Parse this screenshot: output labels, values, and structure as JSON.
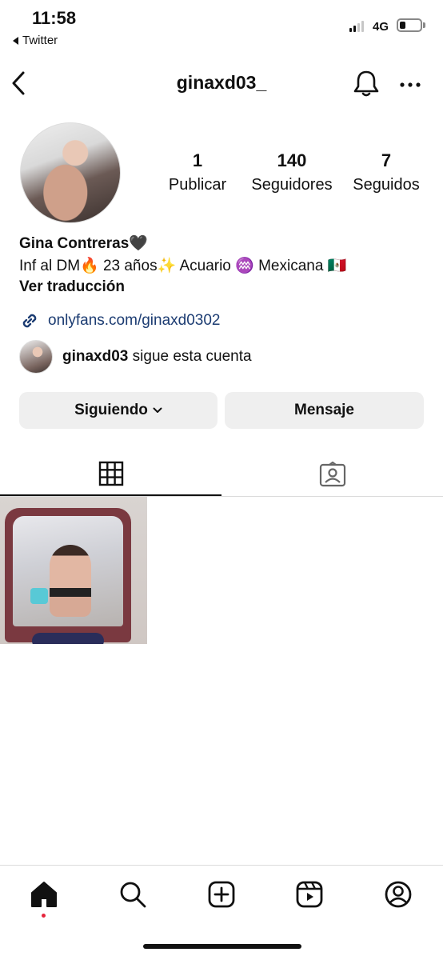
{
  "status_bar": {
    "time": "11:58",
    "back_app": "Twitter",
    "network": "4G"
  },
  "header": {
    "username": "ginaxd03_"
  },
  "profile": {
    "stats": [
      {
        "number": "1",
        "label": "Publicar"
      },
      {
        "number": "140",
        "label": "Seguidores"
      },
      {
        "number": "7",
        "label": "Seguidos"
      }
    ],
    "name": "Gina Contreras🖤",
    "bio": "Inf al DM🔥 23 años✨ Acuario ♒️ Mexicana 🇲🇽",
    "translate_label": "Ver traducción",
    "link": "onlyfans.com/ginaxd0302",
    "followed_by_user": "ginaxd03",
    "followed_by_suffix": " sigue esta cuenta"
  },
  "actions": {
    "following_label": "Siguiendo",
    "message_label": "Mensaje"
  },
  "tabs": [
    {
      "icon": "grid-icon",
      "active": true
    },
    {
      "icon": "tagged-icon",
      "active": false
    }
  ],
  "bottom_nav": [
    {
      "icon": "home-icon",
      "active": true
    },
    {
      "icon": "search-icon"
    },
    {
      "icon": "create-icon"
    },
    {
      "icon": "reels-icon"
    },
    {
      "icon": "profile-icon"
    }
  ],
  "colors": {
    "link": "#1c3c72",
    "button_bg": "#efefef",
    "notification_dot": "#e5243b"
  }
}
